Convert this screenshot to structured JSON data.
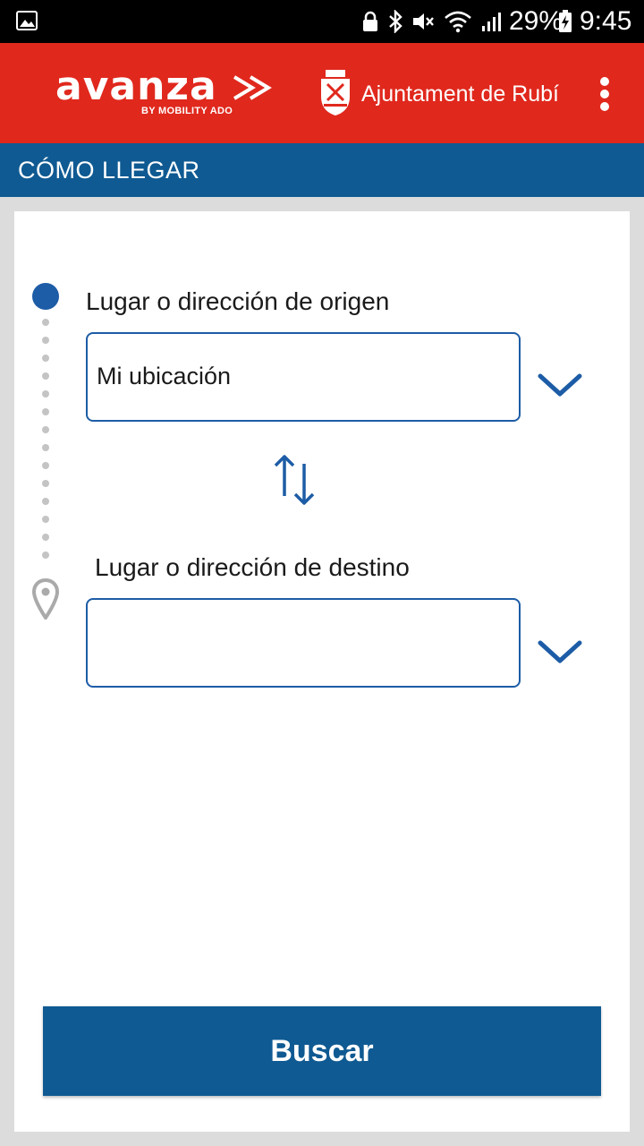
{
  "status_bar": {
    "battery_percent": "29%",
    "time": "9:45",
    "icons": [
      "gallery-icon",
      "lock-icon",
      "bluetooth-icon",
      "mute-icon",
      "wifi-icon",
      "signal-icon",
      "battery-charging-icon"
    ]
  },
  "header": {
    "brand_name": "avanza",
    "brand_tagline": "BY MOBILITY ADO",
    "city_name": "Ajuntament de Rubí",
    "menu_icon": "overflow-menu-icon"
  },
  "section": {
    "title": "CÓMO LLEGAR"
  },
  "route": {
    "origin_label": "Lugar o dirección de origen",
    "origin_value": "Mi ubicación",
    "destination_label": "Lugar o dirección de destino",
    "destination_value": "",
    "swap_icon": "swap-arrows-icon",
    "dropdown_icon": "chevron-down-icon",
    "destination_icon": "map-pin-icon"
  },
  "actions": {
    "search_label": "Buscar"
  },
  "colors": {
    "header_red": "#e0281d",
    "primary_blue": "#0f5a92",
    "accent_blue": "#1d5ca6",
    "background_gray": "#dcdcdc"
  }
}
